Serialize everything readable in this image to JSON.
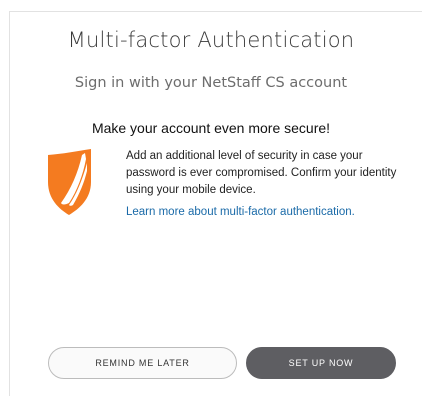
{
  "dialog": {
    "title": "Multi-factor Authentication",
    "subtitle": "Sign in with your NetStaff CS account",
    "headline": "Make your account even more secure!",
    "description": "Add an additional level of security in case your password is ever compromised. Confirm your identity using your mobile device.",
    "learn_more_link": "Learn more about multi-factor authentication.",
    "shield_icon": "shield-icon",
    "colors": {
      "shield": "#f47b20",
      "link": "#1a6aa8",
      "primary_button": "#5e5e62"
    }
  },
  "buttons": {
    "remind_later": "REMIND ME LATER",
    "set_up_now": "SET UP NOW"
  }
}
